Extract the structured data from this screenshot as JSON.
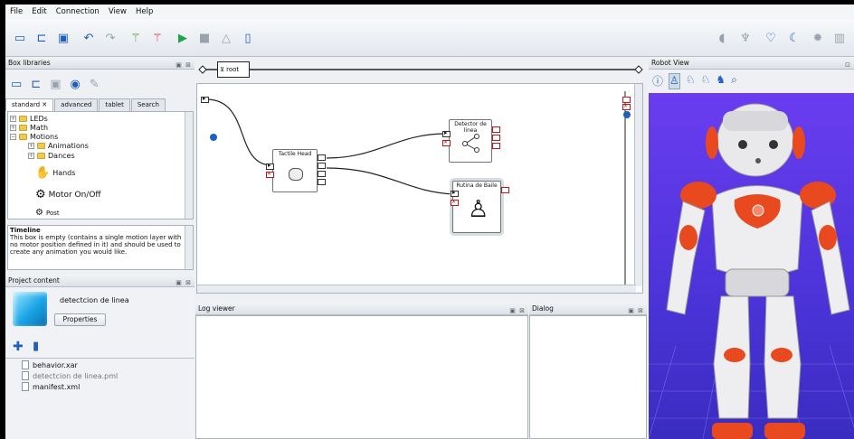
{
  "menu": [
    "File",
    "Edit",
    "Connection",
    "View",
    "Help"
  ],
  "box_libraries": {
    "title": "Box libraries",
    "tabs": [
      "standard",
      "advanced",
      "tablet",
      "Search"
    ],
    "tree": [
      "LEDs",
      "Math",
      "Motions",
      "Animations",
      "Dances",
      "Hands",
      "Motor On/Off",
      "Post"
    ],
    "description_title": "Timeline",
    "description": "This box is empty (contains a single motion layer with no motor position defined in it) and should be used to create any animation you would like."
  },
  "project": {
    "title": "Project content",
    "name": "detectcion de linea",
    "properties_label": "Properties",
    "files": [
      "behavior.xar",
      "detectcion de linea.pml",
      "manifest.xml"
    ]
  },
  "flow": {
    "breadcrumb": "root",
    "boxes": [
      {
        "title": "Tactile Head"
      },
      {
        "title": "Detector de linea"
      },
      {
        "title": "Rutina de Baile"
      }
    ]
  },
  "log_viewer": {
    "title": "Log viewer"
  },
  "dialog": {
    "title": "Dialog"
  },
  "robot_view": {
    "title": "Robot View"
  },
  "colors": {
    "accent": "#1f5fbf",
    "robot_bg": "#4b33d8",
    "robot_orange": "#e8491f"
  }
}
